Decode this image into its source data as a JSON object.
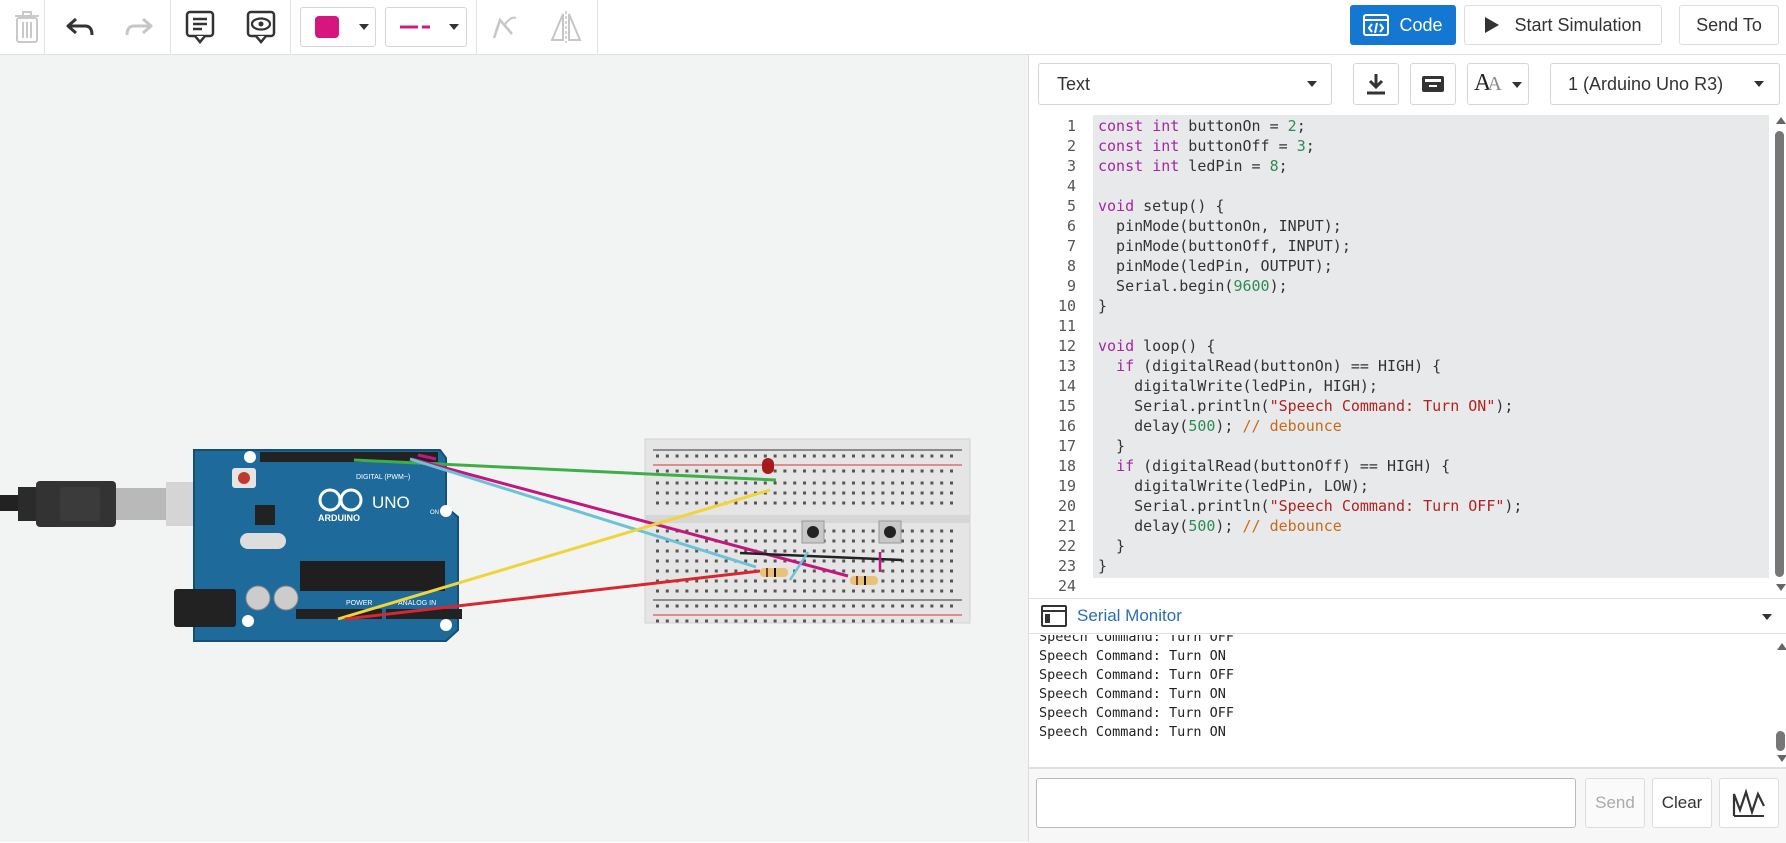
{
  "toolbar": {
    "code_label": "Code",
    "sim_label": "Start Simulation",
    "send_to_label": "Send To",
    "color_swatch": "#d6157f",
    "line_color": "#d6157f"
  },
  "panel": {
    "mode_label": "Text",
    "device_label": "1 (Arduino Uno R3)"
  },
  "code": {
    "line_numbers": [
      "1",
      "2",
      "3",
      "4",
      "5",
      "6",
      "7",
      "8",
      "9",
      "10",
      "11",
      "12",
      "13",
      "14",
      "15",
      "16",
      "17",
      "18",
      "19",
      "20",
      "21",
      "22",
      "23",
      "24"
    ]
  },
  "serial_monitor": {
    "title": "Serial Monitor",
    "lines": [
      "Speech Command: Turn OFF",
      "Speech Command: Turn ON",
      "Speech Command: Turn OFF",
      "Speech Command: Turn ON",
      "Speech Command: Turn OFF",
      "Speech Command: Turn ON"
    ],
    "input_value": "",
    "send_label": "Send",
    "clear_label": "Clear"
  },
  "board": {
    "logo_text": "ARDUINO",
    "model_text": "UNO",
    "digital_label": "DIGITAL (PWM~)",
    "power_label": "POWER",
    "analog_label": "ANALOG IN",
    "on_label": "ON"
  },
  "colors": {
    "accent": "#1477d2",
    "board_blue": "#1e6a9b",
    "wire_green": "#3fae49",
    "wire_magenta": "#c2187d",
    "wire_cyan": "#6cc3d8",
    "wire_yellow": "#efd43a",
    "wire_red": "#d8272f",
    "wire_black": "#222222"
  }
}
